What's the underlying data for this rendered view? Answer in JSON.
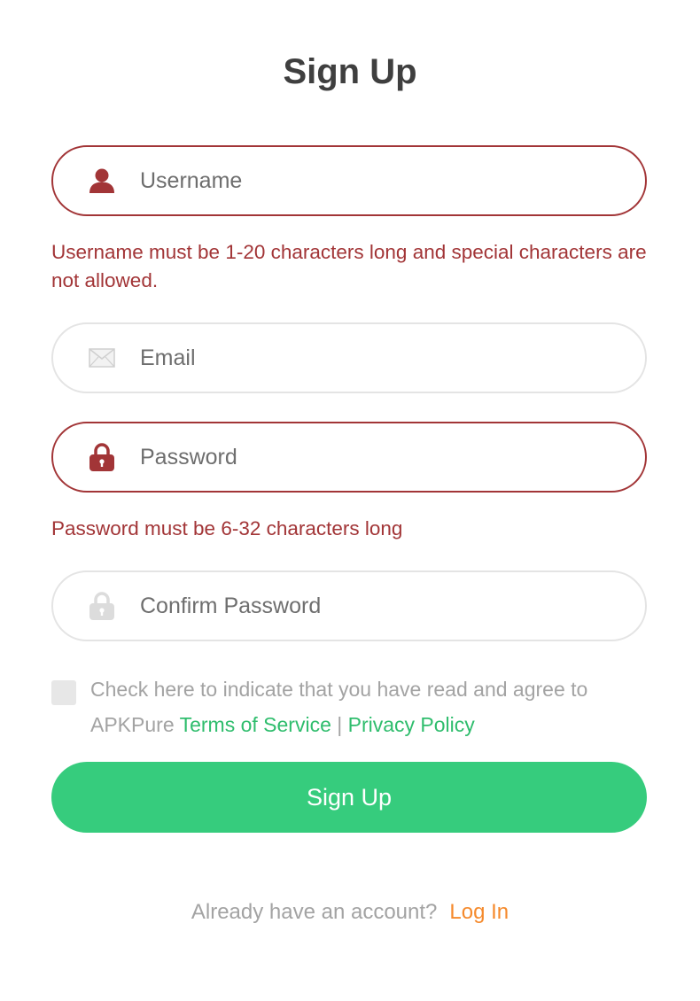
{
  "title": "Sign Up",
  "fields": {
    "username": {
      "placeholder": "Username",
      "value": "",
      "icon": "user-icon",
      "error": "Username must be 1-20 characters long and special characters are not allowed."
    },
    "email": {
      "placeholder": "Email",
      "value": "",
      "icon": "envelope-icon"
    },
    "password": {
      "placeholder": "Password",
      "value": "",
      "icon": "lock-icon",
      "error": "Password must be 6-32 characters long"
    },
    "confirm_password": {
      "placeholder": "Confirm Password",
      "value": "",
      "icon": "lock-icon"
    }
  },
  "agreement": {
    "text": "Check here to indicate that you have read and agree to APKPure",
    "terms_link": "Terms of Service",
    "separator": "|",
    "privacy_link": "Privacy Policy",
    "checked": false
  },
  "submit_label": "Sign Up",
  "footer": {
    "prompt": "Already have an account?",
    "login_link": "Log In"
  },
  "colors": {
    "error": "#a23537",
    "accent_green": "#36cc7d",
    "link_green": "#2fbd6d",
    "login_orange": "#f58a2c",
    "muted_text": "#a3a3a3",
    "inactive_icon": "#d9d9d9"
  }
}
